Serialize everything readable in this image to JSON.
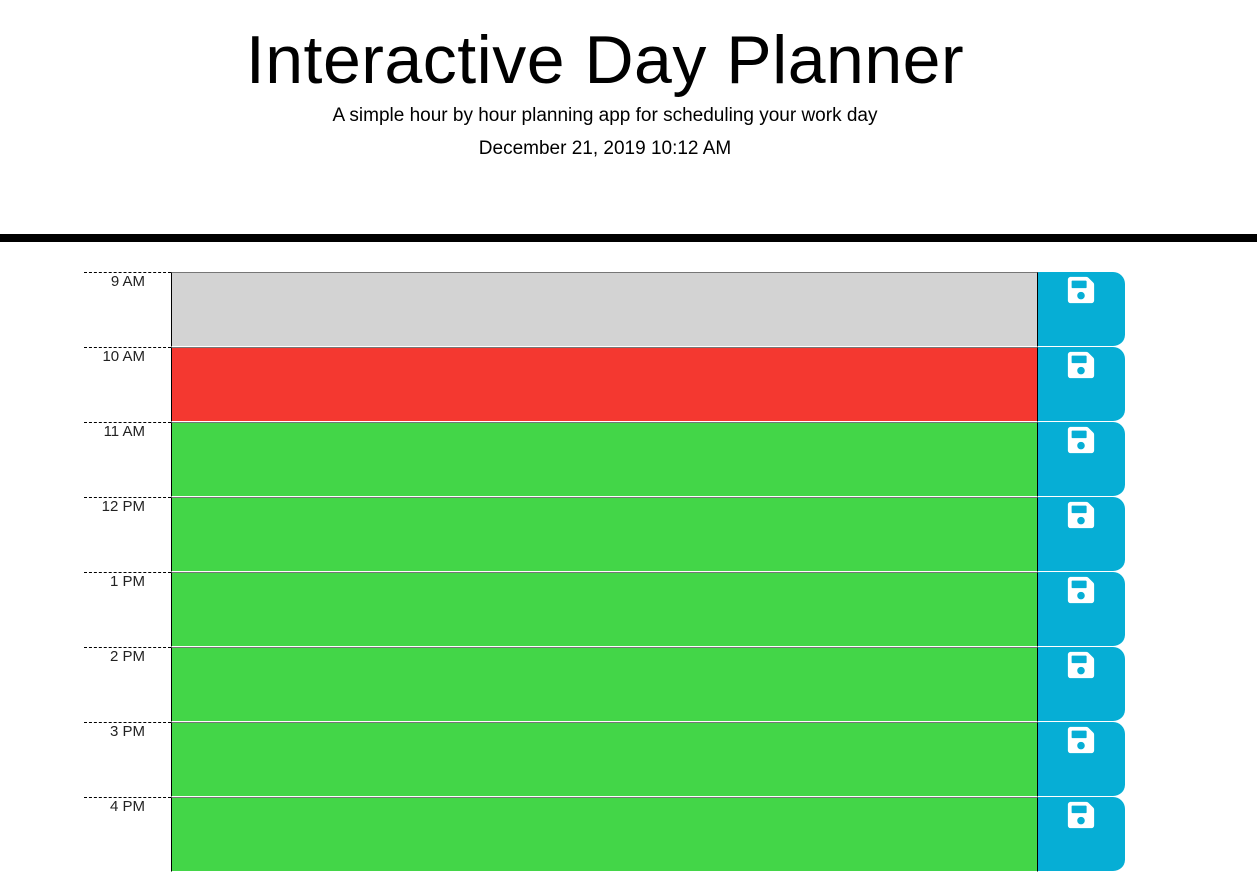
{
  "header": {
    "title": "Interactive Day Planner",
    "subtitle": "A simple hour by hour planning app for scheduling your work day",
    "current_datetime": "December 21, 2019 10:12 AM"
  },
  "colors": {
    "past": "#d3d3d3",
    "present": "#f43830",
    "future": "#43d648",
    "save_button": "#06aed5"
  },
  "time_blocks": [
    {
      "hour_label": "9 AM",
      "status": "past",
      "text": "",
      "save_icon": "floppy-disk-icon"
    },
    {
      "hour_label": "10 AM",
      "status": "present",
      "text": "",
      "save_icon": "floppy-disk-icon"
    },
    {
      "hour_label": "11 AM",
      "status": "future",
      "text": "",
      "save_icon": "floppy-disk-icon"
    },
    {
      "hour_label": "12 PM",
      "status": "future",
      "text": "",
      "save_icon": "floppy-disk-icon"
    },
    {
      "hour_label": "1 PM",
      "status": "future",
      "text": "",
      "save_icon": "floppy-disk-icon"
    },
    {
      "hour_label": "2 PM",
      "status": "future",
      "text": "",
      "save_icon": "floppy-disk-icon"
    },
    {
      "hour_label": "3 PM",
      "status": "future",
      "text": "",
      "save_icon": "floppy-disk-icon"
    },
    {
      "hour_label": "4 PM",
      "status": "future",
      "text": "",
      "save_icon": "floppy-disk-icon"
    }
  ]
}
